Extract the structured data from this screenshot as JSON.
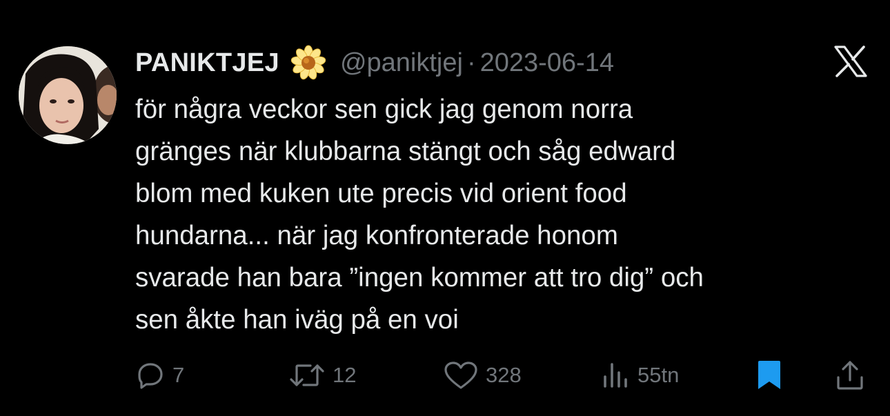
{
  "author": {
    "display_name": "PANIKTJEJ",
    "handle": "@paniktjej",
    "separator": "·",
    "date": "2023-06-14"
  },
  "tweet": {
    "lines": [
      "för några veckor sen gick jag genom norra",
      "gränges när klubbarna stängt och såg edward",
      "blom med kuken ute precis vid orient food",
      "hundarna... när jag konfronterade honom",
      "svarade han bara ”ingen kommer att tro dig” och",
      "sen åkte han iväg på en voi"
    ]
  },
  "actions": {
    "replies": "7",
    "retweets": "12",
    "likes": "328",
    "views": "55tn"
  },
  "colors": {
    "background": "#000000",
    "text": "#e7e9ea",
    "muted": "#71767b",
    "bookmark_active": "#1d9bf0"
  },
  "icons": [
    "daisy-emoji",
    "x-logo-icon",
    "reply-icon",
    "retweet-icon",
    "like-icon",
    "views-icon",
    "bookmark-icon",
    "share-icon"
  ]
}
